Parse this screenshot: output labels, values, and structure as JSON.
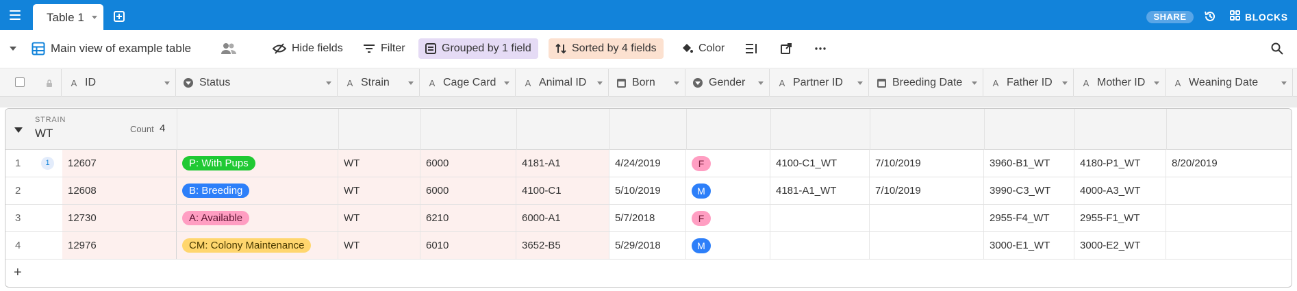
{
  "app": {
    "tab_label": "Table 1",
    "share_label": "SHARE",
    "blocks_label": "BLOCKS",
    "accent": "#1283da"
  },
  "viewbar": {
    "view_name": "Main view of example table",
    "hide_fields": "Hide fields",
    "filter": "Filter",
    "grouped": "Grouped by 1 field",
    "sorted": "Sorted by 4 fields",
    "color": "Color"
  },
  "columns": [
    {
      "label": "ID",
      "icon": "text-field-icon"
    },
    {
      "label": "Status",
      "icon": "single-select-icon"
    },
    {
      "label": "Strain",
      "icon": "text-field-icon"
    },
    {
      "label": "Cage Card",
      "icon": "text-field-icon"
    },
    {
      "label": "Animal ID",
      "icon": "text-field-icon"
    },
    {
      "label": "Born",
      "icon": "date-field-icon"
    },
    {
      "label": "Gender",
      "icon": "single-select-icon"
    },
    {
      "label": "Partner ID",
      "icon": "text-field-icon"
    },
    {
      "label": "Breeding Date",
      "icon": "date-field-icon"
    },
    {
      "label": "Father ID",
      "icon": "text-field-icon"
    },
    {
      "label": "Mother ID",
      "icon": "text-field-icon"
    },
    {
      "label": "Weaning Date",
      "icon": "text-field-icon"
    }
  ],
  "group": {
    "field_label": "STRAIN",
    "value": "WT",
    "count_label": "Count",
    "count": "4"
  },
  "rows": [
    {
      "num": "1",
      "comments": "1",
      "id": "12607",
      "status": "P: With Pups",
      "status_color": "#20c933",
      "status_text_color": "#ffffff",
      "strain": "WT",
      "cage": "6000",
      "animal": "4181-A1",
      "born": "4/24/2019",
      "gender": "F",
      "gender_color": "#ff9ec2",
      "gender_text_color": "#7a1f3d",
      "partner": "4100-C1_WT",
      "breeding": "7/10/2019",
      "father": "3960-B1_WT",
      "mother": "4180-P1_WT",
      "weaning": "8/20/2019"
    },
    {
      "num": "2",
      "comments": "",
      "id": "12608",
      "status": "B: Breeding",
      "status_color": "#2d7ff9",
      "status_text_color": "#ffffff",
      "strain": "WT",
      "cage": "6000",
      "animal": "4100-C1",
      "born": "5/10/2019",
      "gender": "M",
      "gender_color": "#2d7ff9",
      "gender_text_color": "#ffffff",
      "partner": "4181-A1_WT",
      "breeding": "7/10/2019",
      "father": "3990-C3_WT",
      "mother": "4000-A3_WT",
      "weaning": ""
    },
    {
      "num": "3",
      "comments": "",
      "id": "12730",
      "status": "A: Available",
      "status_color": "#ff9ec2",
      "status_text_color": "#5a1230",
      "strain": "WT",
      "cage": "6210",
      "animal": "6000-A1",
      "born": "5/7/2018",
      "gender": "F",
      "gender_color": "#ff9ec2",
      "gender_text_color": "#7a1f3d",
      "partner": "",
      "breeding": "",
      "father": "2955-F4_WT",
      "mother": "2955-F1_WT",
      "weaning": ""
    },
    {
      "num": "4",
      "comments": "",
      "id": "12976",
      "status": "CM: Colony Maintenance",
      "status_color": "#ffd66e",
      "status_text_color": "#4a3a00",
      "strain": "WT",
      "cage": "6010",
      "animal": "3652-B5",
      "born": "5/29/2018",
      "gender": "M",
      "gender_color": "#2d7ff9",
      "gender_text_color": "#ffffff",
      "partner": "",
      "breeding": "",
      "father": "3000-E1_WT",
      "mother": "3000-E2_WT",
      "weaning": ""
    }
  ]
}
